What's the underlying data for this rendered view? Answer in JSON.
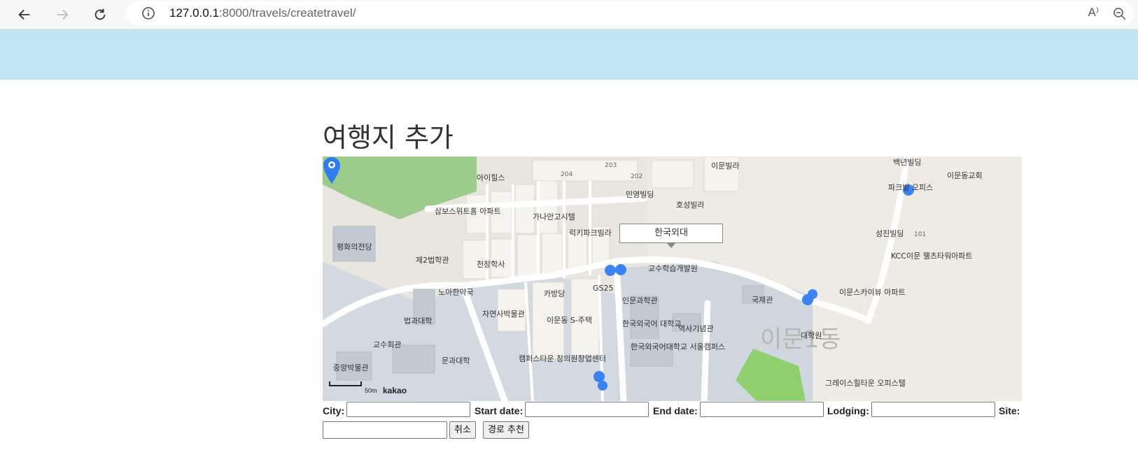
{
  "browser": {
    "url_host": "127.0.0.1",
    "url_path": ":8000/travels/createtravel/",
    "read_aloud_label": "A⁾",
    "icons": [
      "back-icon",
      "forward-icon",
      "refresh-icon",
      "info-icon",
      "read-aloud-icon",
      "zoom-icon"
    ]
  },
  "page": {
    "title": "여행지 추가"
  },
  "map": {
    "infowindow": "한국외대",
    "scale_label": "50m",
    "brand": "kakao",
    "district_label": "이문1동",
    "places": [
      "아이힐스",
      "이문빌라",
      "백년빌딩",
      "이문동교회",
      "삼보스위트홈 아파트",
      "민영빌딩",
      "호성빌라",
      "파크빌 오피스",
      "가나안고시텔",
      "럭키파크빌라",
      "성진빌딩",
      "KCC이문 웰츠타워아파트",
      "평화의전당",
      "제2법학관",
      "천장학사",
      "교수학습개발원",
      "노아한약국",
      "카방당",
      "GS25",
      "인문과학관",
      "국제관",
      "이문스카이뷰 아파트",
      "법과대학",
      "자연사박물관",
      "이문동 S-주택",
      "한국외국어 대학교",
      "역사기념관",
      "대학원",
      "교수회관",
      "캠퍼스타운 창의원창업센터",
      "한국외국어대학교 서울캠퍼스",
      "문과대학",
      "중앙박물관",
      "그레이스힐타운 오피스텔"
    ],
    "road_numbers": [
      "204",
      "203",
      "202",
      "101"
    ]
  },
  "form": {
    "city_label": "City:",
    "start_label": "Start date:",
    "end_label": "End date:",
    "lodging_label": "Lodging:",
    "site_label": "Site:",
    "city_value": "",
    "start_value": "",
    "end_value": "",
    "lodging_value": "",
    "site_value": "",
    "cancel_label": "취소",
    "recommend_label": "경로 추천"
  },
  "colors": {
    "header_band": "#bfe5f4",
    "map_land": "#e9e6df",
    "park": "#9ccc8a",
    "campus": "#d0d6de",
    "marker": "#2f7bf0"
  }
}
